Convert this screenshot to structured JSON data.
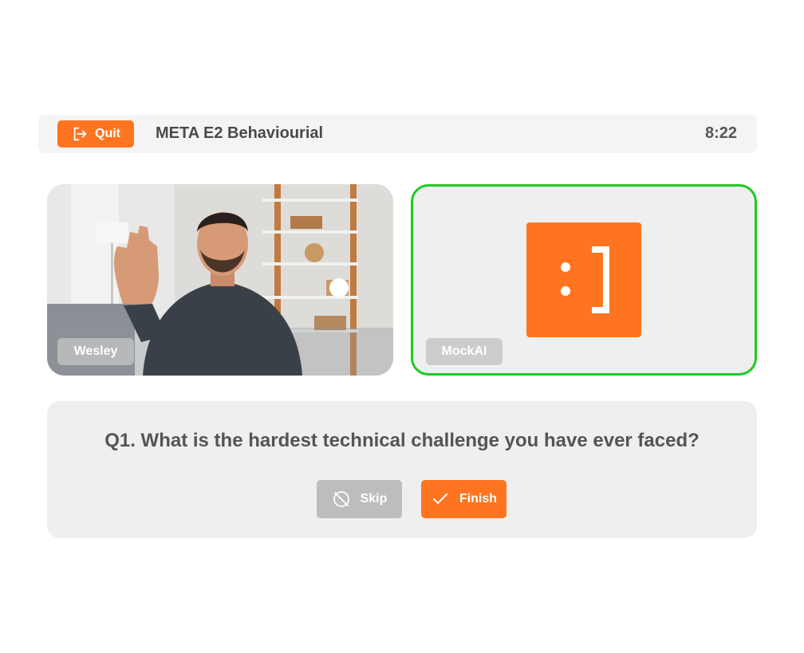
{
  "header": {
    "quit_label": "Quit",
    "session_title": "META E2 Behaviourial",
    "timer": "8:22"
  },
  "participants": {
    "user_name": "Wesley",
    "ai_name": "MockAI",
    "ai_avatar_text": ": ]"
  },
  "question": {
    "text": "Q1. What is the hardest technical challenge you have ever faced?",
    "skip_label": "Skip",
    "finish_label": "Finish"
  },
  "icons": {
    "quit": "logout-icon",
    "skip": "skip-slash-circle-icon",
    "finish": "checkmark-icon"
  },
  "colors": {
    "accent": "#ff7420",
    "active_speaker_border": "#1fc925",
    "disabled_button": "#bdbdbd"
  }
}
